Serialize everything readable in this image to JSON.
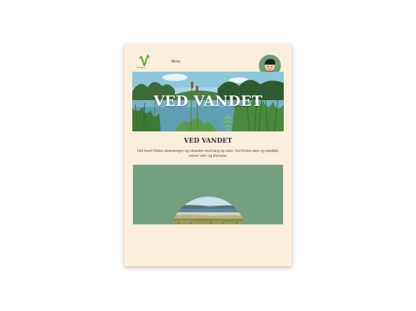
{
  "header": {
    "logo_text": "Vild Mad",
    "menu_label": "Menu"
  },
  "hero": {
    "title": "VED VANDET"
  },
  "section": {
    "heading": "VED VANDET",
    "description": "Ved havet findes strandengen og stranden med tang og urter. Ved ferske søer og vandløb, vokser urter og blomster."
  },
  "colors": {
    "page_background": "#fbeedb",
    "accent_green": "#73a07f",
    "logo_green": "#5cb030",
    "avatar_ring": "#6f9b7a"
  },
  "icons": {
    "logo": "leaf-v-logo",
    "avatar": "child-avatar-icon"
  }
}
